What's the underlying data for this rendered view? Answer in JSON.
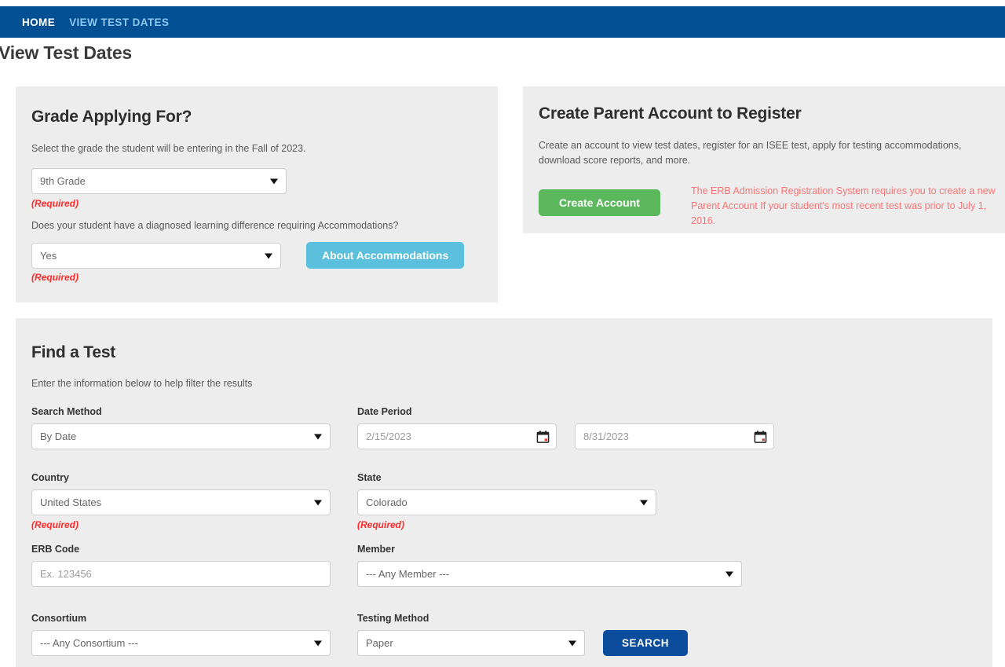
{
  "nav": {
    "items": [
      {
        "label": "HOME",
        "current": false
      },
      {
        "label": "VIEW TEST DATES",
        "current": true
      }
    ]
  },
  "page": {
    "title": "View Test Dates"
  },
  "grade_card": {
    "title": "Grade Applying For?",
    "description": "Select the grade the student will be entering in the Fall of 2023.",
    "grade_select_value": "9th Grade",
    "grade_required_label": "(Required)",
    "accommodations_question": "Does your student have a diagnosed learning difference requiring Accommodations?",
    "accommodations_select_value": "Yes",
    "accommodations_required_label": "(Required)",
    "about_accommodations_button": "About Accommodations"
  },
  "parent_card": {
    "title": "Create Parent Account to Register",
    "description": "Create an account to view test dates, register for an ISEE test, apply for testing accommodations, download score reports, and more.",
    "create_account_button": "Create Account",
    "warning": "The ERB Admission Registration System requires you to create a new Parent Account If your student's most recent test was prior to July 1, 2016."
  },
  "find_card": {
    "title": "Find a Test",
    "description": "Enter the information below to help filter the results",
    "fields": {
      "search_method": {
        "label": "Search Method",
        "value": "By Date"
      },
      "date_period": {
        "label": "Date Period",
        "start_value": "2/15/2023",
        "end_value": "8/31/2023",
        "icon": "calendar-icon"
      },
      "country": {
        "label": "Country",
        "value": "United States",
        "required_label": "(Required)"
      },
      "state": {
        "label": "State",
        "value": "Colorado",
        "required_label": "(Required)"
      },
      "erb_code": {
        "label": "ERB Code",
        "placeholder": "Ex. 123456",
        "value": ""
      },
      "member": {
        "label": "Member",
        "value": "--- Any Member ---"
      },
      "consortium": {
        "label": "Consortium",
        "value": "--- Any Consortium ---"
      },
      "testing_method": {
        "label": "Testing Method",
        "value": "Paper"
      }
    },
    "search_button": "SEARCH"
  },
  "colors": {
    "nav_blue": "#034f94",
    "card_gray": "#ededed",
    "accent_info": "#5bc0de",
    "accent_success": "#5cb85c",
    "accent_primary": "#0b4d9c",
    "required_red": "#ff2a2a",
    "warning_red": "#fa7474"
  }
}
